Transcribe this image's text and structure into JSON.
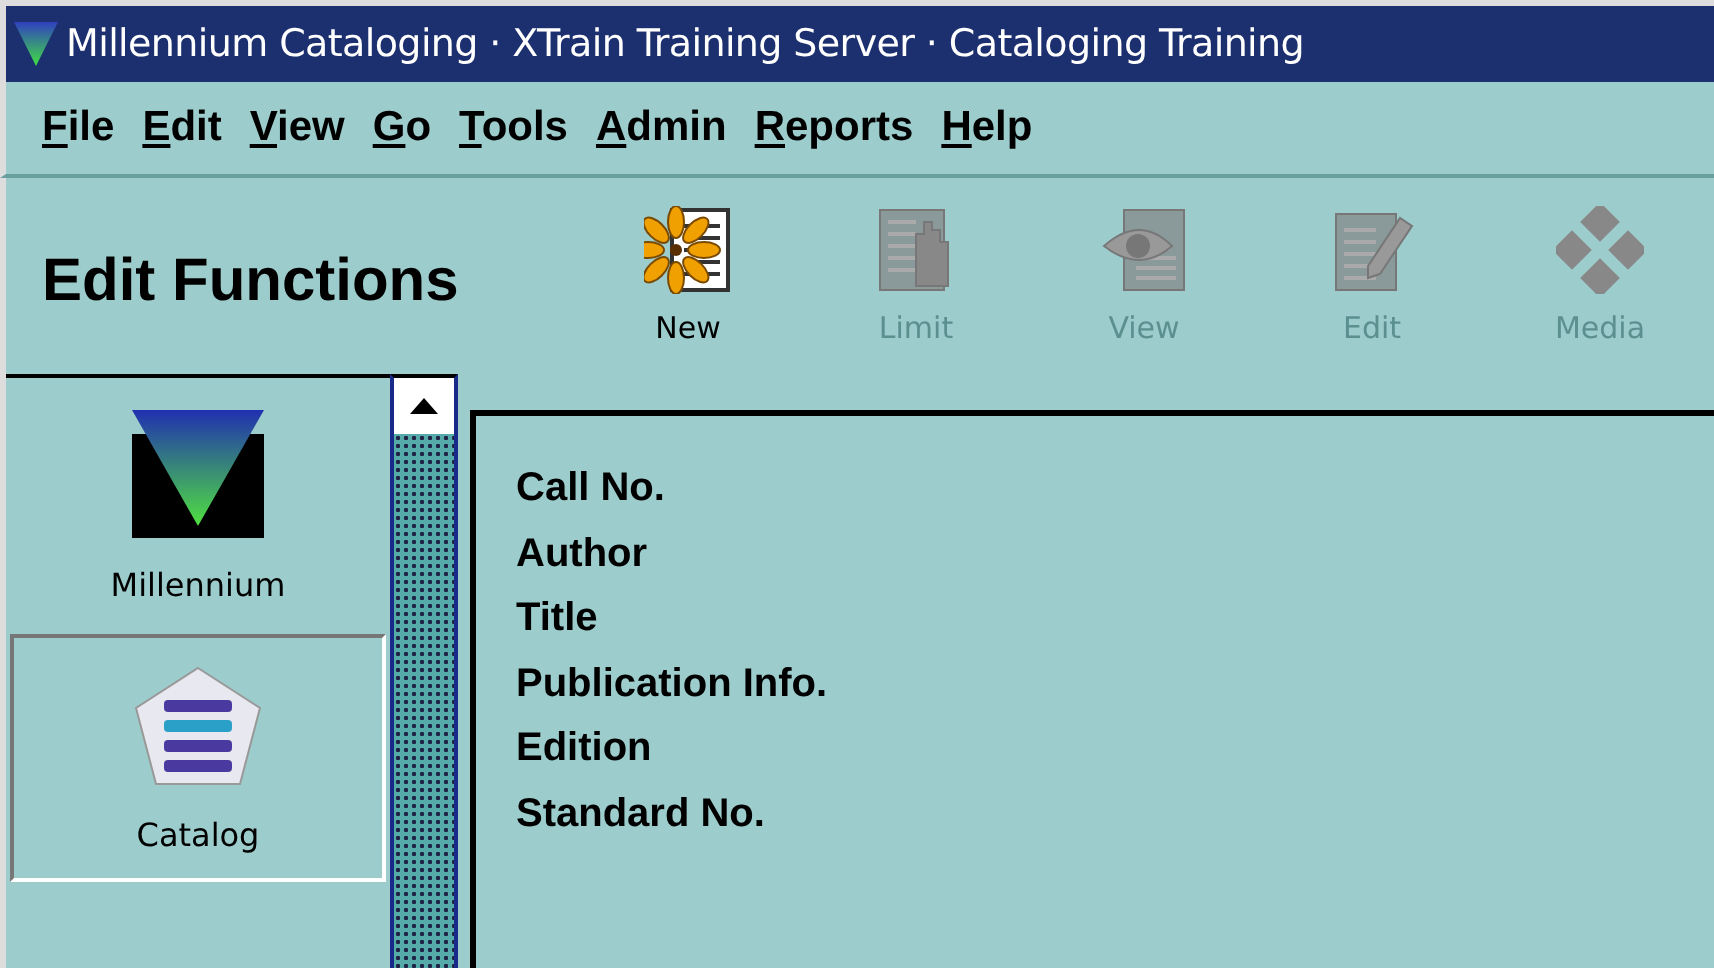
{
  "window": {
    "title": "Millennium Cataloging · XTrain Training Server · Cataloging Training"
  },
  "menu": [
    "File",
    "Edit",
    "View",
    "Go",
    "Tools",
    "Admin",
    "Reports",
    "Help"
  ],
  "heading": "Edit Functions",
  "toolbar": [
    {
      "kind": "new",
      "label": "New",
      "disabled": false
    },
    {
      "kind": "limit",
      "label": "Limit",
      "disabled": true
    },
    {
      "kind": "view",
      "label": "View",
      "disabled": true
    },
    {
      "kind": "edit",
      "label": "Edit",
      "disabled": true
    },
    {
      "kind": "media",
      "label": "Media",
      "disabled": true
    }
  ],
  "sidebar": {
    "items": [
      {
        "kind": "millennium",
        "label": "Millennium",
        "selected": false
      },
      {
        "kind": "catalog",
        "label": "Catalog",
        "selected": true
      }
    ]
  },
  "fields": [
    "Call No.",
    "Author",
    "Title",
    "Publication Info.",
    "Edition",
    "Standard No."
  ]
}
